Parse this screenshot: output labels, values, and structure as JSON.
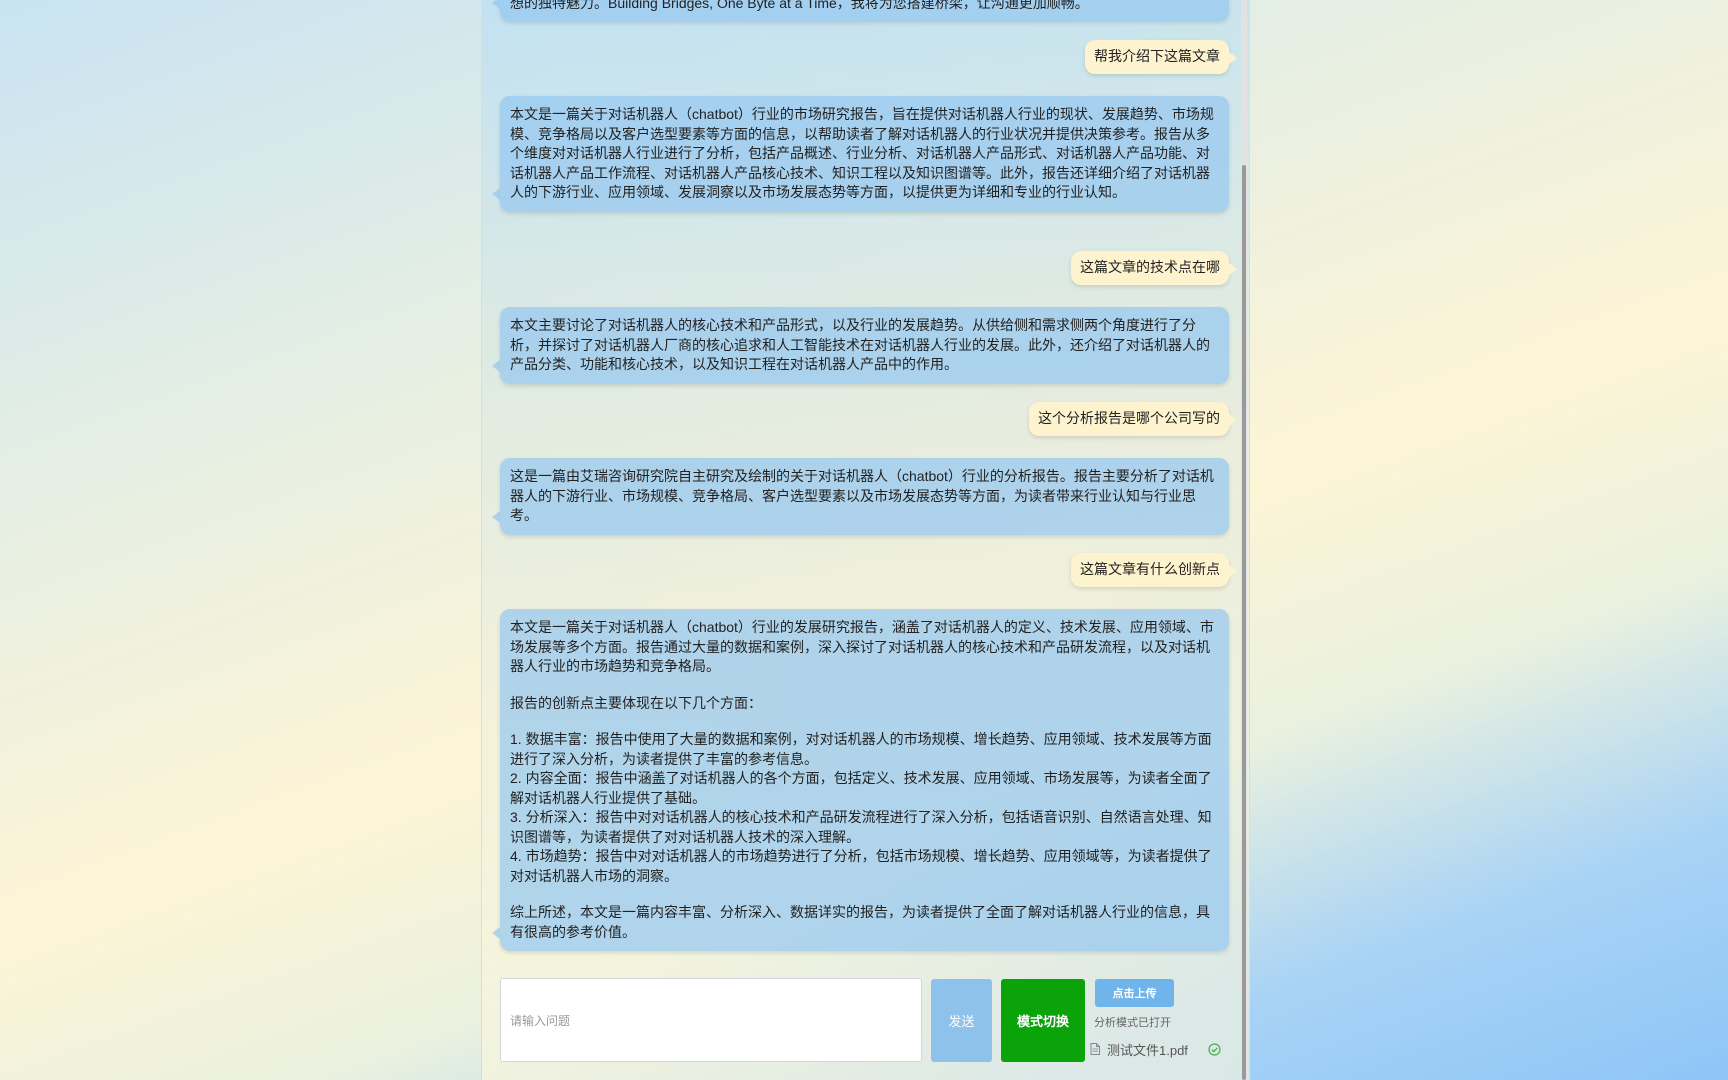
{
  "messages": {
    "m0": {
      "role": "bot",
      "lines": [
        "想的独特魅力。Building Bridges, One Byte at a Time，我将为您搭建桥梁，让沟通更加顺畅。"
      ]
    },
    "m1": {
      "role": "user",
      "text": "帮我介绍下这篇文章"
    },
    "m2": {
      "role": "bot",
      "text": "本文是一篇关于对话机器人（chatbot）行业的市场研究报告，旨在提供对话机器人行业的现状、发展趋势、市场规模、竞争格局以及客户选型要素等方面的信息，以帮助读者了解对话机器人的行业状况并提供决策参考。报告从多个维度对对话机器人行业进行了分析，包括产品概述、行业分析、对话机器人产品形式、对话机器人产品功能、对话机器人产品工作流程、对话机器人产品核心技术、知识工程以及知识图谱等。此外，报告还详细介绍了对话机器人的下游行业、应用领域、发展洞察以及市场发展态势等方面，以提供更为详细和专业的行业认知。"
    },
    "m3": {
      "role": "user",
      "text": "这篇文章的技术点在哪"
    },
    "m4": {
      "role": "bot",
      "text": "本文主要讨论了对话机器人的核心技术和产品形式，以及行业的发展趋势。从供给侧和需求侧两个角度进行了分析，并探讨了对话机器人厂商的核心追求和人工智能技术在对话机器人行业的发展。此外，还介绍了对话机器人的产品分类、功能和核心技术，以及知识工程在对话机器人产品中的作用。"
    },
    "m5": {
      "role": "user",
      "text": "这个分析报告是哪个公司写的"
    },
    "m6": {
      "role": "bot",
      "text": "这是一篇由艾瑞咨询研究院自主研究及绘制的关于对话机器人（chatbot）行业的分析报告。报告主要分析了对话机器人的下游行业、市场规模、竞争格局、客户选型要素以及市场发展态势等方面，为读者带来行业认知与行业思考。"
    },
    "m7": {
      "role": "user",
      "text": "这篇文章有什么创新点"
    },
    "m8": {
      "role": "bot",
      "intro": "本文是一篇关于对话机器人（chatbot）行业的发展研究报告，涵盖了对话机器人的定义、技术发展、应用领域、市场发展等多个方面。报告通过大量的数据和案例，深入探讨了对话机器人的核心技术和产品研发流程，以及对话机器人行业的市场趋势和竞争格局。",
      "lead": "报告的创新点主要体现在以下几个方面：",
      "points": [
        "1. 数据丰富：报告中使用了大量的数据和案例，对对话机器人的市场规模、增长趋势、应用领域、技术发展等方面进行了深入分析，为读者提供了丰富的参考信息。",
        "2. 内容全面：报告中涵盖了对话机器人的各个方面，包括定义、技术发展、应用领域、市场发展等，为读者全面了解对话机器人行业提供了基础。",
        "3. 分析深入：报告中对对话机器人的核心技术和产品研发流程进行了深入分析，包括语音识别、自然语言处理、知识图谱等，为读者提供了对对话机器人技术的深入理解。",
        "4. 市场趋势：报告中对对话机器人的市场趋势进行了分析，包括市场规模、增长趋势、应用领域等，为读者提供了对对话机器人市场的洞察。"
      ],
      "summary": "综上所述，本文是一篇内容丰富、分析深入、数据详实的报告，为读者提供了全面了解对话机器人行业的信息，具有很高的参考价值。"
    }
  },
  "composer": {
    "placeholder": "请输入问题",
    "send_label": "发送",
    "mode_label": "模式切换",
    "upload_label": "点击上传",
    "mode_status": "分析模式已打开",
    "file_name": "测试文件1.pdf"
  },
  "icons": {
    "file": "file-icon",
    "check": "check-circle-icon"
  },
  "colors": {
    "bot_bubble": "#96c8f0",
    "user_bubble": "#fdf3cf",
    "mode_button": "#0aa30a",
    "send_button": "#8ec2ea",
    "upload_button": "#6fb4ea"
  }
}
